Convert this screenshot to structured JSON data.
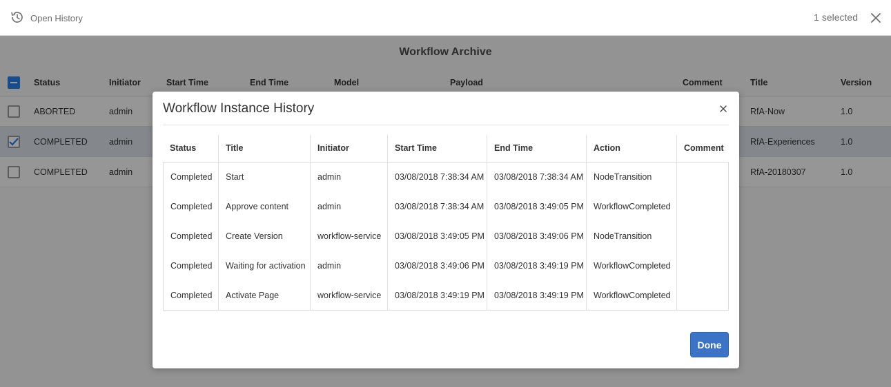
{
  "actionbar": {
    "open_history_label": "Open History",
    "selected_count": "1 selected"
  },
  "archive": {
    "title": "Workflow Archive",
    "columns": [
      "Status",
      "Initiator",
      "Start Time",
      "End Time",
      "Model",
      "Payload",
      "Comment",
      "Title",
      "Version"
    ],
    "rows": [
      {
        "status": "ABORTED",
        "initiator": "admin",
        "title": "RfA-Now",
        "version": "1.0",
        "selected": false
      },
      {
        "status": "COMPLETED",
        "initiator": "admin",
        "title": "RfA-Experiences",
        "version": "1.0",
        "selected": true
      },
      {
        "status": "COMPLETED",
        "initiator": "admin",
        "title": "RfA-20180307",
        "version": "1.0",
        "selected": false
      }
    ]
  },
  "dialog": {
    "title": "Workflow Instance History",
    "columns": [
      "Status",
      "Title",
      "Initiator",
      "Start Time",
      "End Time",
      "Action",
      "Comment"
    ],
    "rows": [
      {
        "status": "Completed",
        "title": "Start",
        "initiator": "admin",
        "start": "03/08/2018 7:38:34 AM",
        "end": "03/08/2018 7:38:34 AM",
        "action": "NodeTransition",
        "comment": ""
      },
      {
        "status": "Completed",
        "title": "Approve content",
        "initiator": "admin",
        "start": "03/08/2018 7:38:34 AM",
        "end": "03/08/2018 3:49:05 PM",
        "action": "WorkflowCompleted",
        "comment": ""
      },
      {
        "status": "Completed",
        "title": "Create Version",
        "initiator": "workflow-service",
        "start": "03/08/2018 3:49:05 PM",
        "end": "03/08/2018 3:49:06 PM",
        "action": "NodeTransition",
        "comment": ""
      },
      {
        "status": "Completed",
        "title": "Waiting for activation",
        "initiator": "admin",
        "start": "03/08/2018 3:49:06 PM",
        "end": "03/08/2018 3:49:19 PM",
        "action": "WorkflowCompleted",
        "comment": ""
      },
      {
        "status": "Completed",
        "title": "Activate Page",
        "initiator": "workflow-service",
        "start": "03/08/2018 3:49:19 PM",
        "end": "03/08/2018 3:49:19 PM",
        "action": "WorkflowCompleted",
        "comment": ""
      }
    ],
    "done_label": "Done"
  },
  "icons": {
    "history": "history-icon",
    "close": "close-icon",
    "checkmark": "checkmark-icon"
  },
  "colors": {
    "accent": "#3b73c7",
    "checkbox_accent": "#2680eb",
    "selected_row": "#dde3ec"
  }
}
